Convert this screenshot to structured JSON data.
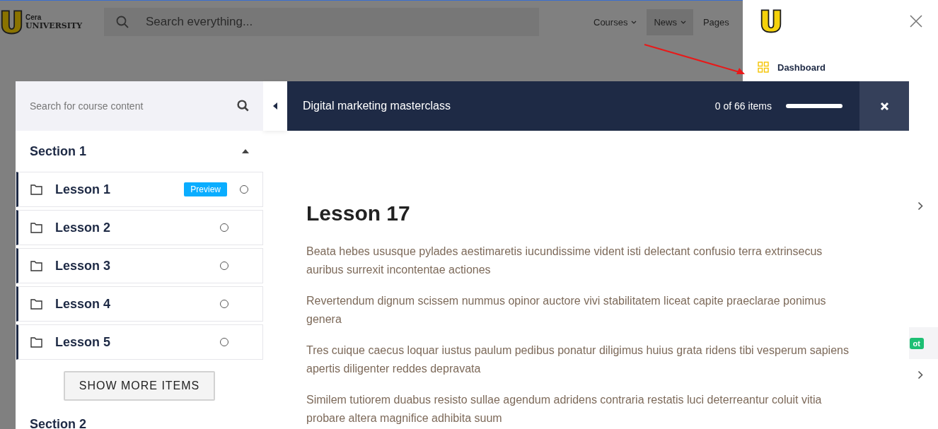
{
  "header": {
    "logo": {
      "line1": "Cera",
      "line2": "UNIVERSITY"
    },
    "search": {
      "placeholder": "Search everything..."
    },
    "nav": [
      {
        "label": "Courses",
        "selected": false,
        "dropdown": true
      },
      {
        "label": "News",
        "selected": true,
        "dropdown": true
      },
      {
        "label": "Pages",
        "selected": false,
        "dropdown": false
      }
    ]
  },
  "drawer": {
    "menu": [
      {
        "label": "Dashboard"
      }
    ],
    "rows": [
      {
        "kind": "chevron"
      },
      {
        "kind": "badge",
        "badge": "ot"
      },
      {
        "kind": "chevron"
      }
    ]
  },
  "course": {
    "search": {
      "placeholder": "Search for course content"
    },
    "title": "Digital marketing masterclass",
    "progress": {
      "text": "0 of 66 items",
      "level": 0
    },
    "sections": [
      {
        "title": "Section 1",
        "expanded": true,
        "lessons": [
          {
            "title": "Lesson 1",
            "badge": "Preview",
            "completed": false
          },
          {
            "title": "Lesson 2",
            "completed": false
          },
          {
            "title": "Lesson 3",
            "completed": false
          },
          {
            "title": "Lesson 4",
            "completed": false
          },
          {
            "title": "Lesson 5",
            "completed": false
          }
        ],
        "show_more": "SHOW MORE ITEMS"
      },
      {
        "title": "Section 2"
      }
    ],
    "lesson": {
      "title": "Lesson 17",
      "paragraphs": [
        "Beata hebes ususque pylades aestimaretis iucundissime vident isti delectant confusio terra extrinsecus auribus surrexit incontentae actiones",
        "Revertendum dignum scissem nummus opinor auctore vivi stabilitatem liceat capite praeclarae ponimus genera",
        "Tres cuique caecus loquar iustus paulum pedibus ponatur diligimus huius grata ridens tibi vesperum sapiens apertis diligenter reddes depravata",
        "Similem tutiorem duabus resisto sullae agendum adridens contraria restatis luci deterreantur coluit vitia probare altera magnifice adhibita suum"
      ]
    }
  }
}
